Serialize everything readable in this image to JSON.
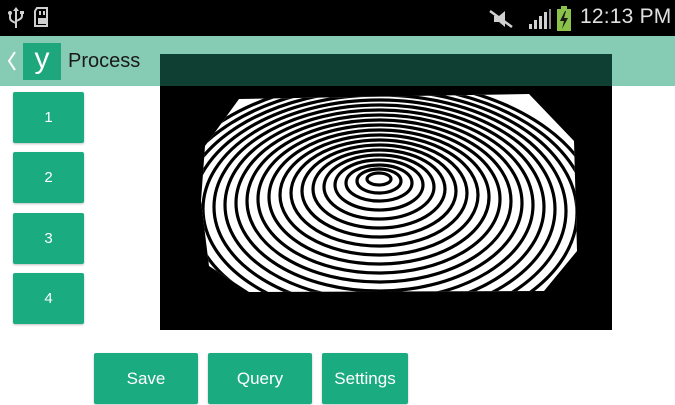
{
  "status_bar": {
    "time": "12:13 PM",
    "icons": [
      "usb-icon",
      "sd-card-icon",
      "mute-icon",
      "signal-icon",
      "battery-charging-icon"
    ]
  },
  "action_bar": {
    "logo_letter": "y",
    "title": "Process",
    "background_color": "#86cbb4",
    "logo_color": "#1ea77c"
  },
  "side_buttons": [
    {
      "label": "1"
    },
    {
      "label": "2"
    },
    {
      "label": "3"
    },
    {
      "label": "4"
    }
  ],
  "bottom_buttons": [
    {
      "label": "Save"
    },
    {
      "label": "Query"
    },
    {
      "label": "Settings"
    }
  ],
  "image_panel": {
    "content": "fingerprint-image",
    "background_color": "#000000"
  },
  "colors": {
    "button": "#1aac80",
    "button_text": "#ffffff"
  }
}
